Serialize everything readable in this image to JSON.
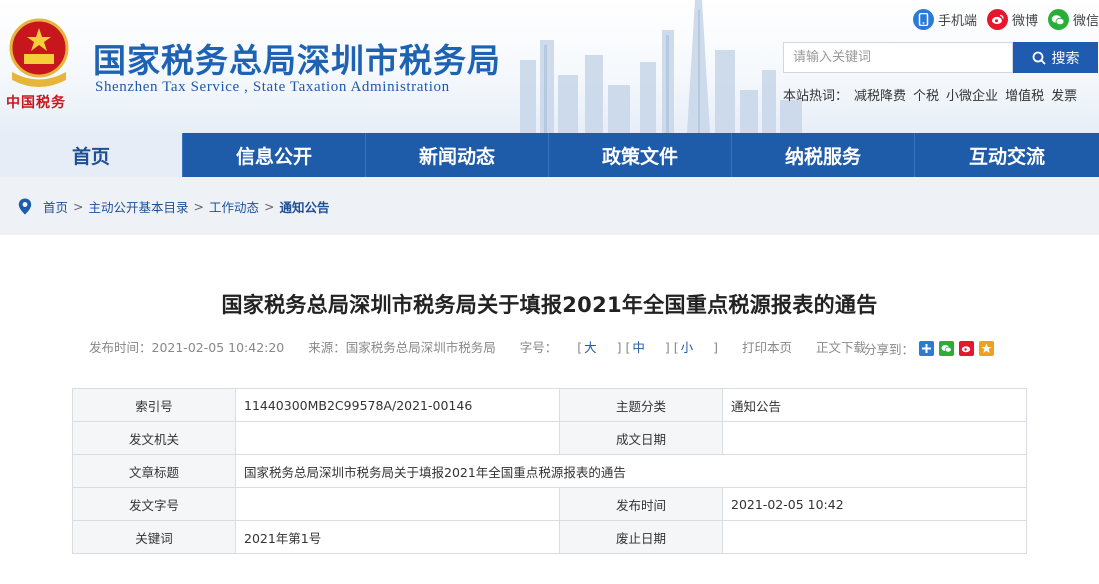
{
  "header": {
    "emblem_text": "中国税务",
    "site_title": "国家税务总局深圳市税务局",
    "site_subtitle": "Shenzhen Tax Service , State Taxation Administration",
    "top_links": [
      {
        "label": "手机端",
        "icon": "mobile-icon",
        "color": "#2b7bd6"
      },
      {
        "label": "微博",
        "icon": "weibo-icon",
        "color": "#e6162d"
      },
      {
        "label": "微信",
        "icon": "wechat-icon",
        "color": "#2bad39"
      }
    ],
    "search": {
      "placeholder": "请输入关键词",
      "button_label": "搜索"
    },
    "hot": {
      "label": "本站热词：",
      "words": [
        "减税降费",
        "个税",
        "小微企业",
        "增值税",
        "发票"
      ]
    }
  },
  "nav": {
    "items": [
      {
        "label": "首页",
        "active": true
      },
      {
        "label": "信息公开",
        "active": false
      },
      {
        "label": "新闻动态",
        "active": false
      },
      {
        "label": "政策文件",
        "active": false
      },
      {
        "label": "纳税服务",
        "active": false
      },
      {
        "label": "互动交流",
        "active": false
      }
    ]
  },
  "breadcrumb": {
    "items": [
      "首页",
      "主动公开基本目录",
      "工作动态"
    ],
    "separator": ">",
    "current": "通知公告"
  },
  "article": {
    "title": "国家税务总局深圳市税务局关于填报2021年全国重点税源报表的通告",
    "publish_time": "发布时间：2021-02-05 10:42:20",
    "source": "来源：国家税务总局深圳市税务局",
    "font_size_label": "字号：",
    "font_sizes": [
      "大",
      "中",
      "小"
    ],
    "print_label": "打印本页",
    "download_label": "正文下载",
    "share_label": "分享到：",
    "share_icons": [
      "qzone-icon",
      "wechat-share-icon",
      "weibo-share-icon",
      "star-icon"
    ]
  },
  "info_table": {
    "rows": [
      [
        {
          "label": "索引号",
          "value": "11440300MB2C99578A/2021-00146"
        },
        {
          "label": "主题分类",
          "value": "通知公告"
        }
      ],
      [
        {
          "label": "发文机关",
          "value": ""
        },
        {
          "label": "成文日期",
          "value": ""
        }
      ],
      [
        {
          "label": "文章标题",
          "value": "国家税务总局深圳市税务局关于填报2021年全国重点税源报表的通告",
          "full": true
        }
      ],
      [
        {
          "label": "发文字号",
          "value": ""
        },
        {
          "label": "发布时间",
          "value": "2021-02-05 10:42"
        }
      ],
      [
        {
          "label": "关键词",
          "value": "2021年第1号"
        },
        {
          "label": "废止日期",
          "value": ""
        }
      ]
    ]
  },
  "colors": {
    "brand": "#1e5ba9",
    "title_blue": "#1e63b3",
    "emblem_red": "#c8161d"
  }
}
